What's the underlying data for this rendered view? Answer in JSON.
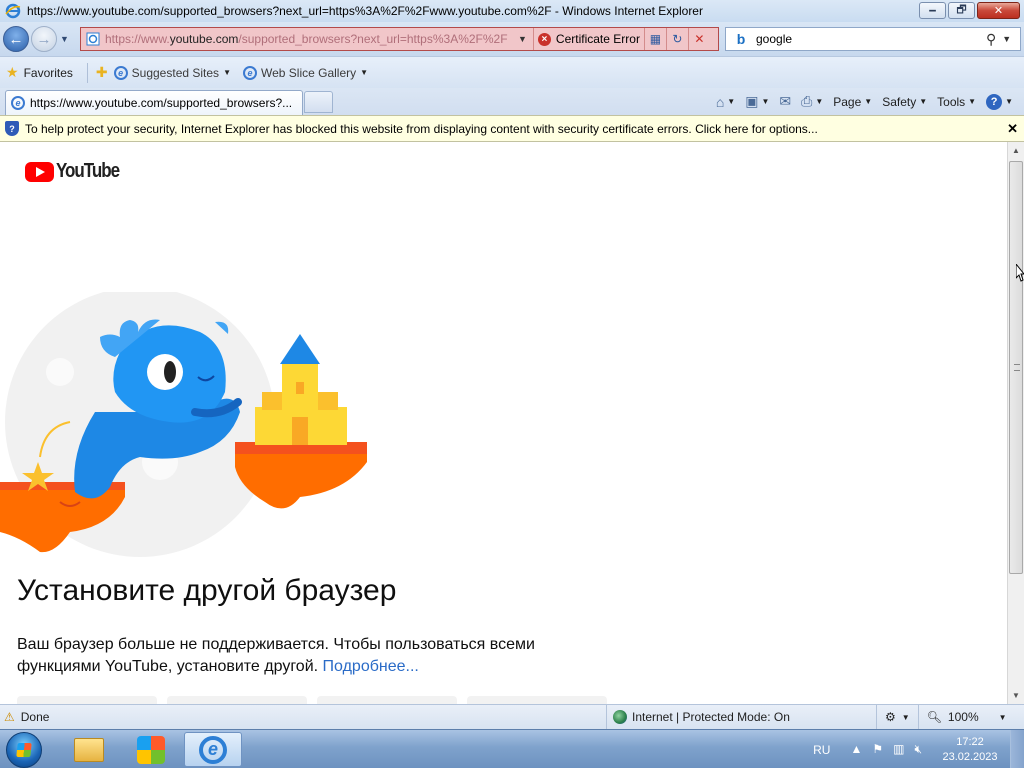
{
  "window": {
    "title": "https://www.youtube.com/supported_browsers?next_url=https%3A%2F%2Fwww.youtube.com%2F - Windows Internet Explorer",
    "minimize_label": "🗕",
    "restore_label": "🗗",
    "close_label": "✕"
  },
  "address_bar": {
    "url_prefix": "https://www.",
    "url_domain": "youtube.com",
    "url_suffix": "/supported_browsers?next_url=https%3A%2F%2F",
    "certificate_error_label": "Certificate Error",
    "back_label": "←",
    "forward_label": "→"
  },
  "search": {
    "value": "google",
    "provider_icon": "bing-icon"
  },
  "favorites_bar": {
    "favorites_label": "Favorites",
    "items": [
      {
        "label": "Suggested Sites",
        "icon": "ie-page-icon"
      },
      {
        "label": "Web Slice Gallery",
        "icon": "ie-page-icon"
      }
    ]
  },
  "tabs": [
    {
      "label": "https://www.youtube.com/supported_browsers?..."
    }
  ],
  "command_bar": {
    "page_label": "Page",
    "safety_label": "Safety",
    "tools_label": "Tools",
    "help_label": "?"
  },
  "info_bar": {
    "message": "To help protect your security, Internet Explorer has blocked this website from displaying content with security certificate errors. Click here for options...",
    "close_label": "✕"
  },
  "page": {
    "logo_text": "YouTube",
    "headline": "Установите другой браузер",
    "body": "Ваш браузер больше не поддерживается. Чтобы пользоваться всеми функциями YouTube, установите другой.",
    "learn_more": "Подробнее..."
  },
  "status_bar": {
    "status": "Done",
    "zone": "Internet | Protected Mode: On",
    "zoom": "100%"
  },
  "taskbar": {
    "language": "RU",
    "time": "17:22",
    "date": "23.02.2023"
  },
  "colors": {
    "youtube_red": "#ff0000",
    "link_blue": "#2a6bc7",
    "infobar_bg": "#ffffe1",
    "address_error_bg": "#f1c6c9"
  }
}
